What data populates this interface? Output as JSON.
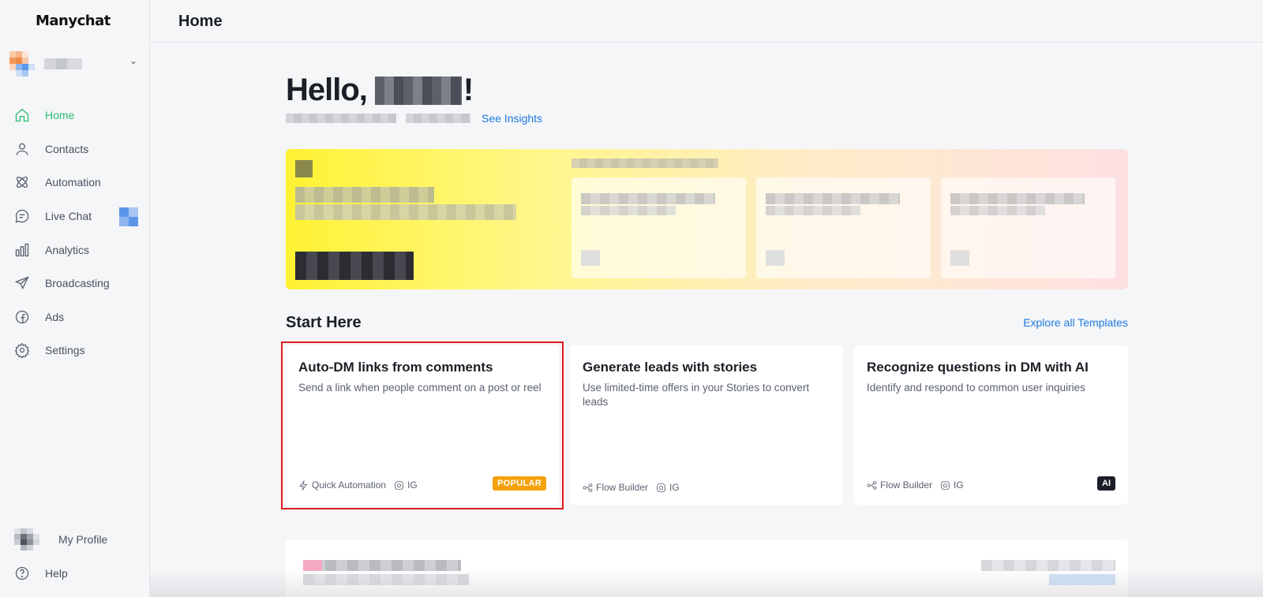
{
  "app": {
    "logo_text": "Manychat",
    "page_title": "Home"
  },
  "sidebar": {
    "items": [
      {
        "label": "Home",
        "icon": "home-icon",
        "active": true
      },
      {
        "label": "Contacts",
        "icon": "user-icon"
      },
      {
        "label": "Automation",
        "icon": "automation-icon"
      },
      {
        "label": "Live Chat",
        "icon": "chat-icon"
      },
      {
        "label": "Analytics",
        "icon": "bar-chart-icon"
      },
      {
        "label": "Broadcasting",
        "icon": "send-icon"
      },
      {
        "label": "Ads",
        "icon": "facebook-icon"
      },
      {
        "label": "Settings",
        "icon": "gear-icon"
      }
    ],
    "bottom": [
      {
        "label": "My Profile",
        "icon": "avatar"
      },
      {
        "label": "Help",
        "icon": "help-icon"
      }
    ]
  },
  "greeting": {
    "prefix": "Hello,",
    "suffix": "!",
    "insights_link": "See Insights"
  },
  "start_here": {
    "title": "Start Here",
    "explore_link": "Explore all Templates",
    "cards": [
      {
        "title": "Auto-DM links from comments",
        "description": "Send a link when people comment on a post or reel",
        "tool": "Quick Automation",
        "channel": "IG",
        "badge": "POPULAR"
      },
      {
        "title": "Generate leads with stories",
        "description": "Use limited-time offers in your Stories to convert leads",
        "tool": "Flow Builder",
        "channel": "IG"
      },
      {
        "title": "Recognize questions in DM with AI",
        "description": "Identify and respond to common user inquiries",
        "tool": "Flow Builder",
        "channel": "IG",
        "badge": "AI"
      }
    ]
  },
  "colors": {
    "accent_green": "#2dbd6e",
    "link_blue": "#1e79e0",
    "popular_orange": "#f5a10b",
    "highlight_red": "#e01d1d"
  }
}
